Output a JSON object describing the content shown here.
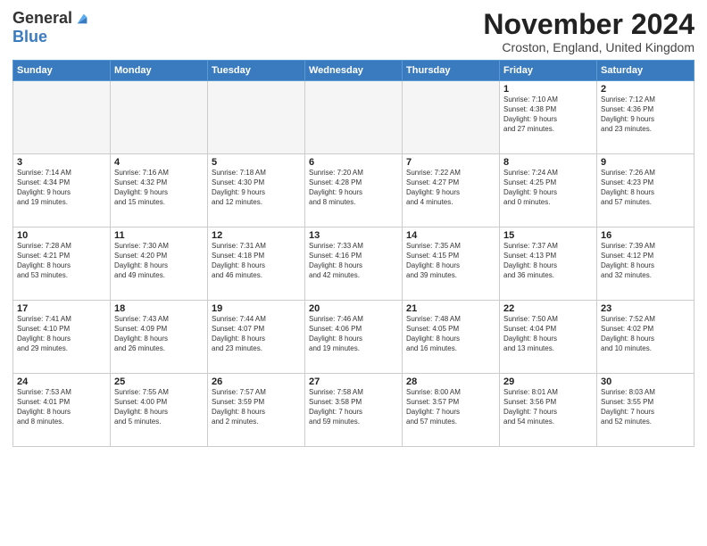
{
  "logo": {
    "general": "General",
    "blue": "Blue"
  },
  "header": {
    "month": "November 2024",
    "location": "Croston, England, United Kingdom"
  },
  "weekdays": [
    "Sunday",
    "Monday",
    "Tuesday",
    "Wednesday",
    "Thursday",
    "Friday",
    "Saturday"
  ],
  "weeks": [
    [
      {
        "day": "",
        "info": ""
      },
      {
        "day": "",
        "info": ""
      },
      {
        "day": "",
        "info": ""
      },
      {
        "day": "",
        "info": ""
      },
      {
        "day": "",
        "info": ""
      },
      {
        "day": "1",
        "info": "Sunrise: 7:10 AM\nSunset: 4:38 PM\nDaylight: 9 hours\nand 27 minutes."
      },
      {
        "day": "2",
        "info": "Sunrise: 7:12 AM\nSunset: 4:36 PM\nDaylight: 9 hours\nand 23 minutes."
      }
    ],
    [
      {
        "day": "3",
        "info": "Sunrise: 7:14 AM\nSunset: 4:34 PM\nDaylight: 9 hours\nand 19 minutes."
      },
      {
        "day": "4",
        "info": "Sunrise: 7:16 AM\nSunset: 4:32 PM\nDaylight: 9 hours\nand 15 minutes."
      },
      {
        "day": "5",
        "info": "Sunrise: 7:18 AM\nSunset: 4:30 PM\nDaylight: 9 hours\nand 12 minutes."
      },
      {
        "day": "6",
        "info": "Sunrise: 7:20 AM\nSunset: 4:28 PM\nDaylight: 9 hours\nand 8 minutes."
      },
      {
        "day": "7",
        "info": "Sunrise: 7:22 AM\nSunset: 4:27 PM\nDaylight: 9 hours\nand 4 minutes."
      },
      {
        "day": "8",
        "info": "Sunrise: 7:24 AM\nSunset: 4:25 PM\nDaylight: 9 hours\nand 0 minutes."
      },
      {
        "day": "9",
        "info": "Sunrise: 7:26 AM\nSunset: 4:23 PM\nDaylight: 8 hours\nand 57 minutes."
      }
    ],
    [
      {
        "day": "10",
        "info": "Sunrise: 7:28 AM\nSunset: 4:21 PM\nDaylight: 8 hours\nand 53 minutes."
      },
      {
        "day": "11",
        "info": "Sunrise: 7:30 AM\nSunset: 4:20 PM\nDaylight: 8 hours\nand 49 minutes."
      },
      {
        "day": "12",
        "info": "Sunrise: 7:31 AM\nSunset: 4:18 PM\nDaylight: 8 hours\nand 46 minutes."
      },
      {
        "day": "13",
        "info": "Sunrise: 7:33 AM\nSunset: 4:16 PM\nDaylight: 8 hours\nand 42 minutes."
      },
      {
        "day": "14",
        "info": "Sunrise: 7:35 AM\nSunset: 4:15 PM\nDaylight: 8 hours\nand 39 minutes."
      },
      {
        "day": "15",
        "info": "Sunrise: 7:37 AM\nSunset: 4:13 PM\nDaylight: 8 hours\nand 36 minutes."
      },
      {
        "day": "16",
        "info": "Sunrise: 7:39 AM\nSunset: 4:12 PM\nDaylight: 8 hours\nand 32 minutes."
      }
    ],
    [
      {
        "day": "17",
        "info": "Sunrise: 7:41 AM\nSunset: 4:10 PM\nDaylight: 8 hours\nand 29 minutes."
      },
      {
        "day": "18",
        "info": "Sunrise: 7:43 AM\nSunset: 4:09 PM\nDaylight: 8 hours\nand 26 minutes."
      },
      {
        "day": "19",
        "info": "Sunrise: 7:44 AM\nSunset: 4:07 PM\nDaylight: 8 hours\nand 23 minutes."
      },
      {
        "day": "20",
        "info": "Sunrise: 7:46 AM\nSunset: 4:06 PM\nDaylight: 8 hours\nand 19 minutes."
      },
      {
        "day": "21",
        "info": "Sunrise: 7:48 AM\nSunset: 4:05 PM\nDaylight: 8 hours\nand 16 minutes."
      },
      {
        "day": "22",
        "info": "Sunrise: 7:50 AM\nSunset: 4:04 PM\nDaylight: 8 hours\nand 13 minutes."
      },
      {
        "day": "23",
        "info": "Sunrise: 7:52 AM\nSunset: 4:02 PM\nDaylight: 8 hours\nand 10 minutes."
      }
    ],
    [
      {
        "day": "24",
        "info": "Sunrise: 7:53 AM\nSunset: 4:01 PM\nDaylight: 8 hours\nand 8 minutes."
      },
      {
        "day": "25",
        "info": "Sunrise: 7:55 AM\nSunset: 4:00 PM\nDaylight: 8 hours\nand 5 minutes."
      },
      {
        "day": "26",
        "info": "Sunrise: 7:57 AM\nSunset: 3:59 PM\nDaylight: 8 hours\nand 2 minutes."
      },
      {
        "day": "27",
        "info": "Sunrise: 7:58 AM\nSunset: 3:58 PM\nDaylight: 7 hours\nand 59 minutes."
      },
      {
        "day": "28",
        "info": "Sunrise: 8:00 AM\nSunset: 3:57 PM\nDaylight: 7 hours\nand 57 minutes."
      },
      {
        "day": "29",
        "info": "Sunrise: 8:01 AM\nSunset: 3:56 PM\nDaylight: 7 hours\nand 54 minutes."
      },
      {
        "day": "30",
        "info": "Sunrise: 8:03 AM\nSunset: 3:55 PM\nDaylight: 7 hours\nand 52 minutes."
      }
    ]
  ]
}
